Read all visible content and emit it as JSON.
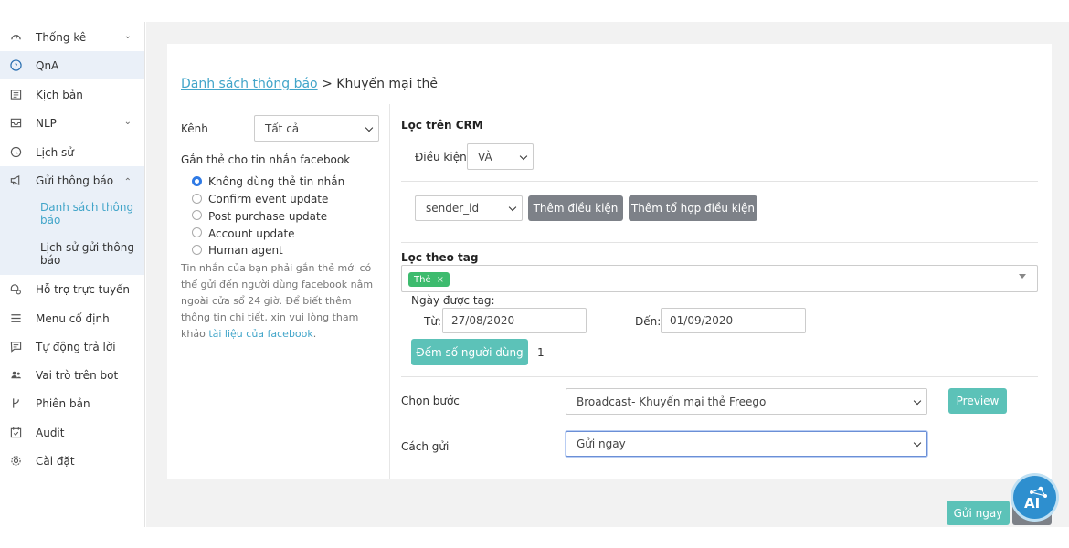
{
  "sidebar": {
    "items": [
      {
        "label": "Thống kê",
        "icon": "gauge-icon",
        "chevron": "down"
      },
      {
        "label": "QnA",
        "icon": "question-icon",
        "chevron": ""
      },
      {
        "label": "Kịch bản",
        "icon": "script-icon",
        "chevron": ""
      },
      {
        "label": "NLP",
        "icon": "inbox-icon",
        "chevron": "down"
      },
      {
        "label": "Lịch sử",
        "icon": "history-icon",
        "chevron": ""
      },
      {
        "label": "Gửi thông báo",
        "icon": "megaphone-icon",
        "chevron": "up"
      },
      {
        "label": "Hỗ trợ trực tuyến",
        "icon": "support-icon",
        "chevron": ""
      },
      {
        "label": "Menu cố định",
        "icon": "menu-icon",
        "chevron": ""
      },
      {
        "label": "Tự động trả lời",
        "icon": "auto-reply-icon",
        "chevron": ""
      },
      {
        "label": "Vai trò trên bot",
        "icon": "users-icon",
        "chevron": ""
      },
      {
        "label": "Phiên bản",
        "icon": "branch-icon",
        "chevron": ""
      },
      {
        "label": "Audit",
        "icon": "calendar-check-icon",
        "chevron": ""
      },
      {
        "label": "Cài đặt",
        "icon": "gear-icon",
        "chevron": ""
      }
    ],
    "sub_items": [
      {
        "label": "Danh sách thông báo"
      },
      {
        "label": "Lịch sử gửi thông báo"
      }
    ]
  },
  "breadcrumb": {
    "link": "Danh sách thông báo",
    "separator": ">",
    "current": "Khuyến mại thẻ"
  },
  "left_panel": {
    "kenh_label": "Kênh",
    "kenh_value": "Tất cả",
    "tag_msg_label": "Gắn thẻ cho tin nhắn facebook",
    "options": [
      "Không dùng thẻ tin nhắn",
      "Confirm event update",
      "Post purchase update",
      "Account update",
      "Human agent"
    ],
    "selected_option": 0,
    "note": "Tin nhắn của bạn phải gắn thẻ mới có thể gửi đến người dùng facebook nằm ngoài cửa sổ 24 giờ. Để biết thêm thông tin chi tiết, xin vui lòng tham khảo",
    "note_link": "tài liệu của facebook",
    "note_end": "."
  },
  "crm": {
    "title": "Lọc trên CRM",
    "condition_label": "Điều kiện",
    "condition_value": "VÀ",
    "field_value": "sender_id",
    "add_condition": "Thêm điều kiện",
    "add_group": "Thêm tổ hợp điều kiện"
  },
  "tag_filter": {
    "title": "Lọc theo tag",
    "tag": "Thẻ",
    "date_label": "Ngày được tag:",
    "from_label": "Từ:",
    "from_value": "27/08/2020",
    "to_label": "Đến:",
    "to_value": "01/09/2020",
    "count_button": "Đếm số người dùng",
    "count_value": "1"
  },
  "step": {
    "label": "Chọn bước",
    "value": "Broadcast- Khuyến mại thẻ Freego",
    "preview": "Preview"
  },
  "send": {
    "label": "Cách gửi",
    "value": "Gửi ngay"
  },
  "footer": {
    "send_now": "Gửi ngay"
  },
  "colors": {
    "accent": "#42a5c9",
    "teal": "#5cc2b8",
    "gray_button": "#7d8188",
    "tag_green": "#3dbb6e",
    "radio_blue": "#2f7ae5"
  }
}
